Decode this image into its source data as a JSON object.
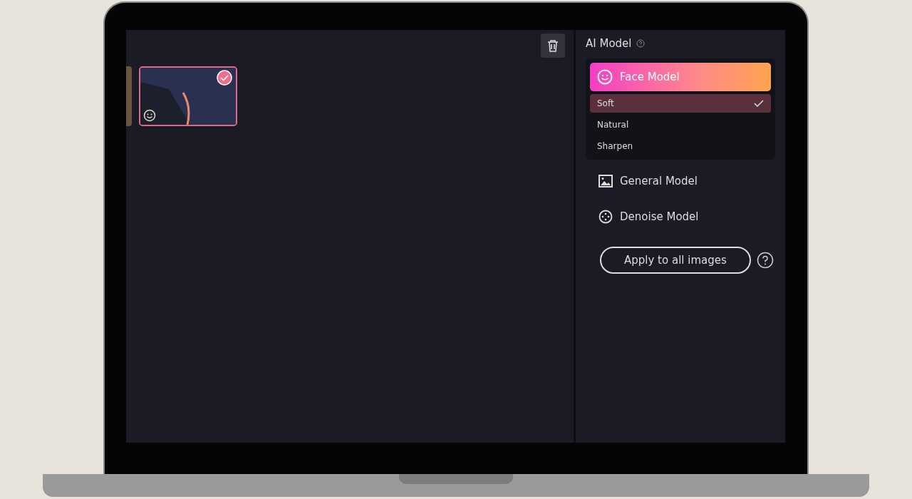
{
  "thumbnails": [
    {
      "kind": "partial",
      "selected": false
    },
    {
      "kind": "full",
      "selected": true
    }
  ],
  "panel": {
    "title": "AI Model",
    "models": [
      {
        "label": "Face Model",
        "kind": "face",
        "selected": true,
        "options": [
          {
            "label": "Soft",
            "selected": true
          },
          {
            "label": "Natural",
            "selected": false
          },
          {
            "label": "Sharpen",
            "selected": false
          }
        ]
      },
      {
        "label": "General Model",
        "kind": "image",
        "selected": false
      },
      {
        "label": "Denoise Model",
        "kind": "denoise",
        "selected": false
      }
    ],
    "apply_button": "Apply to all images"
  }
}
